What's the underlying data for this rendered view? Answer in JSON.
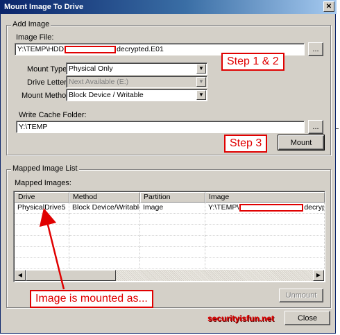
{
  "window": {
    "title": "Mount Image To Drive",
    "close_glyph": "✕"
  },
  "add_image": {
    "legend": "Add Image",
    "image_file_label": "Image File:",
    "image_file_prefix": "Y:\\TEMP\\HDD",
    "image_file_suffix": "decrypted.E01",
    "browse_label": "...",
    "mount_type_label": "Mount Type:",
    "mount_type_value": "Physical Only",
    "drive_letter_label": "Drive Letter:",
    "drive_letter_value": "Next Available (E:)",
    "mount_method_label": "Mount Method:",
    "mount_method_value": "Block Device / Writable",
    "write_cache_label": "Write Cache Folder:",
    "write_cache_value": "Y:\\TEMP",
    "write_cache_browse_label": "...",
    "mount_button": "Mount",
    "dropdown_glyph": "▼"
  },
  "annotations": {
    "step12": "Step 1 & 2",
    "step3": "Step 3",
    "mounted_as": "Image is mounted as...",
    "arrow_color": "#e00000"
  },
  "mapped": {
    "legend": "Mapped Image List",
    "list_label": "Mapped Images:",
    "columns": [
      "Drive",
      "Method",
      "Partition",
      "Image"
    ],
    "rows": [
      {
        "drive": "PhysicalDrive5",
        "method": "Block Device/Writable",
        "partition": "Image",
        "image_prefix": "Y:\\TEMP\\",
        "image_suffix": "decrypt"
      }
    ],
    "unmount_button": "Unmount",
    "scroll_left_glyph": "◀",
    "scroll_right_glyph": "▶"
  },
  "footer": {
    "watermark": "securityisfun.net",
    "close_button": "Close"
  },
  "colors": {
    "accent_red": "#e00000",
    "title_blue": "#0a246a",
    "face": "#d4d0c8"
  }
}
